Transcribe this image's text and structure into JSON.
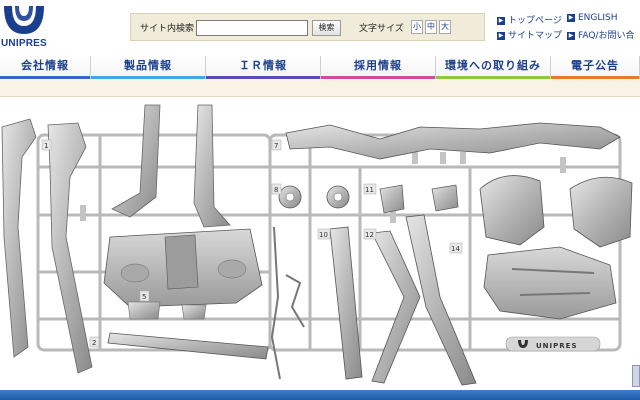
{
  "brand": {
    "logo_text": "UNIPRES",
    "logo_color": "#1b3f8f"
  },
  "header": {
    "search_label": "サイト内検索",
    "search_value": "",
    "search_button": "検索",
    "fontsize_label": "文字サイズ",
    "fontsize_small": "小",
    "fontsize_medium": "中",
    "fontsize_large": "大",
    "links": {
      "top_page": "トップページ",
      "english": "ENGLISH",
      "sitemap": "サイトマップ",
      "faq": "FAQ/お問い合"
    }
  },
  "nav": {
    "items": [
      {
        "label": "会社情報",
        "color": "#3c64c8"
      },
      {
        "label": "製品情報",
        "color": "#3fa8dc"
      },
      {
        "label": "ＩＲ情報",
        "color": "#5a4ab6"
      },
      {
        "label": "採用情報",
        "color": "#d24aa0"
      },
      {
        "label": "環境への取り組み",
        "color": "#8cc83c"
      },
      {
        "label": "電子公告",
        "color": "#e8782a"
      }
    ]
  },
  "hero": {
    "part_numbers": [
      "1",
      "2",
      "5",
      "7",
      "8",
      "10",
      "11",
      "12",
      "14"
    ],
    "badge_text": "UNIPRES"
  },
  "colors": {
    "accent": "#1b3f8f",
    "footer": "#2e6cb8",
    "search_bg": "#f1ecd9"
  }
}
